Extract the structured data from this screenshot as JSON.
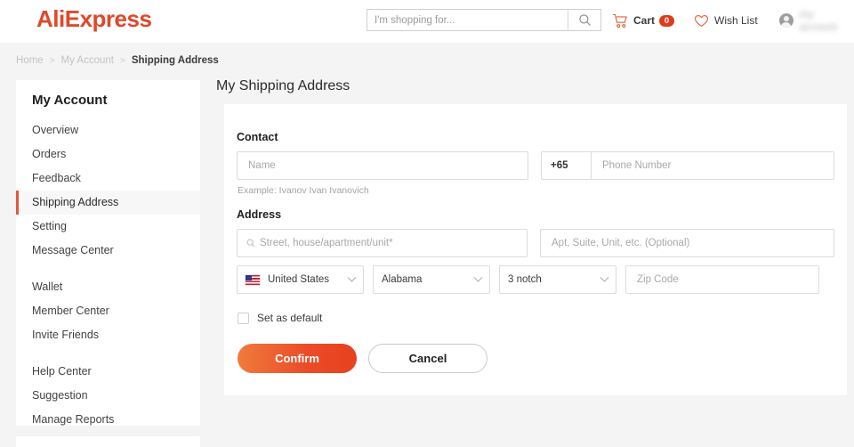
{
  "header": {
    "logo_text": "AliExpress",
    "search": {
      "placeholder": "I'm shopping for...",
      "value": "",
      "icon": "search-icon"
    },
    "cart": {
      "label": "Cart",
      "count": "0",
      "icon": "cart-icon"
    },
    "wishlist": {
      "label": "Wish List",
      "icon": "heart-icon"
    },
    "account": {
      "username": "my account",
      "icon": "avatar-icon"
    }
  },
  "breadcrumb": {
    "items": [
      {
        "label": "Home",
        "current": false
      },
      {
        "label": "My Account",
        "current": false
      },
      {
        "label": "Shipping Address",
        "current": true
      }
    ],
    "separator": ">"
  },
  "sidebar": {
    "title": "My Account",
    "items": [
      {
        "label": "Overview",
        "active": false
      },
      {
        "label": "Orders",
        "active": false
      },
      {
        "label": "Feedback",
        "active": false
      },
      {
        "label": "Shipping Address",
        "active": true
      },
      {
        "label": "Setting",
        "active": false
      },
      {
        "label": "Message Center",
        "active": false
      },
      {
        "label": "Wallet",
        "active": false
      },
      {
        "label": "Member Center",
        "active": false
      },
      {
        "label": "Invite Friends",
        "active": false
      },
      {
        "label": "Help Center",
        "active": false
      },
      {
        "label": "Suggestion",
        "active": false
      },
      {
        "label": "Manage Reports",
        "active": false
      }
    ]
  },
  "main": {
    "page_title": "My Shipping Address",
    "contact": {
      "section_label": "Contact",
      "name_placeholder": "Name",
      "name_value": "",
      "country_code": "+65",
      "phone_placeholder": "Phone Number",
      "phone_value": "",
      "hint": "Example: Ivanov Ivan Ivanovich"
    },
    "address": {
      "section_label": "Address",
      "street_placeholder": "Street, house/apartment/unit*",
      "street_value": "",
      "street_icon": "search-icon",
      "apt_placeholder": "Apt, Suite, Unit, etc. (Optional)",
      "apt_value": "",
      "country": "United States",
      "country_flag": "us-flag-icon",
      "state": "Alabama",
      "city": "3 notch",
      "zip_placeholder": "Zip Code",
      "zip_value": ""
    },
    "set_default_label": "Set as default",
    "set_default_checked": false,
    "confirm_label": "Confirm",
    "cancel_label": "Cancel"
  },
  "colors": {
    "brand": "#e0482a",
    "accent": "#e2583c",
    "badge": "#e03b1c",
    "page_bg": "#f4f4f4"
  }
}
